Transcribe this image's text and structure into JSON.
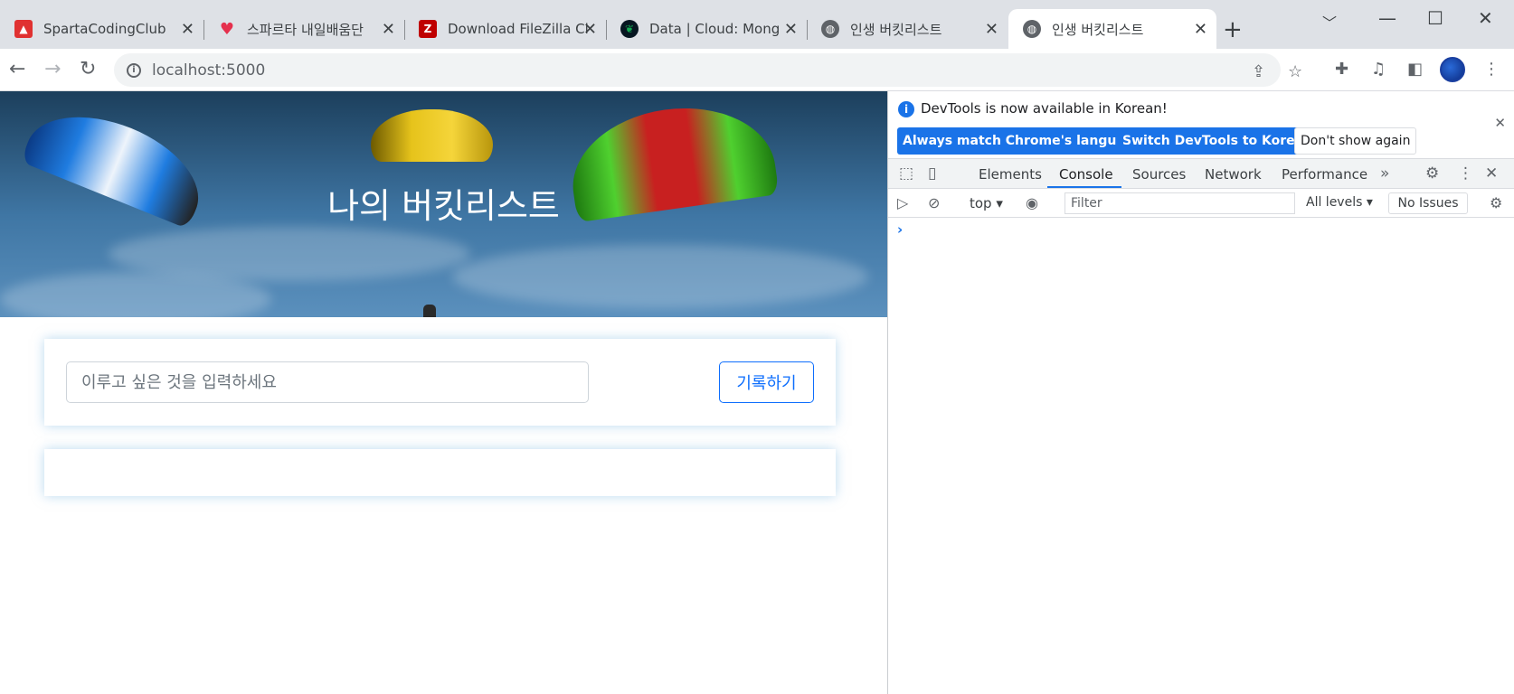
{
  "browser": {
    "tabs": [
      {
        "title": "SpartaCodingClub",
        "icon": "sparta-icon",
        "color": "#e03131"
      },
      {
        "title": "스파르타 내일배움단",
        "icon": "heart-icon",
        "color": "#e5304d"
      },
      {
        "title": "Download FileZilla Cl",
        "icon": "filezilla-icon",
        "color": "#bf0000"
      },
      {
        "title": "Data | Cloud: Mongo",
        "icon": "mongodb-leaf-icon",
        "color": "#13aa52"
      },
      {
        "title": "인생 버킷리스트",
        "icon": "globe-icon",
        "color": "#5f6368"
      },
      {
        "title": "인생 버킷리스트",
        "icon": "globe-icon",
        "color": "#5f6368",
        "active": true
      }
    ],
    "address": "localhost:5000"
  },
  "page": {
    "hero_title": "나의 버킷리스트",
    "input_placeholder": "이루고 싶은 것을 입력하세요",
    "input_value": "",
    "save_label": "기록하기",
    "accent": "#0d6efd"
  },
  "devtools": {
    "notice": "DevTools is now available in Korean!",
    "btn_match": "Always match Chrome's language",
    "btn_switch": "Switch DevTools to Korean",
    "btn_dismiss": "Don't show again",
    "tabs": [
      "Elements",
      "Console",
      "Sources",
      "Network",
      "Performance"
    ],
    "active_tab": "Console",
    "context": "top",
    "filter_placeholder": "Filter",
    "levels": "All levels",
    "issues": "No Issues",
    "prompt": "›"
  }
}
